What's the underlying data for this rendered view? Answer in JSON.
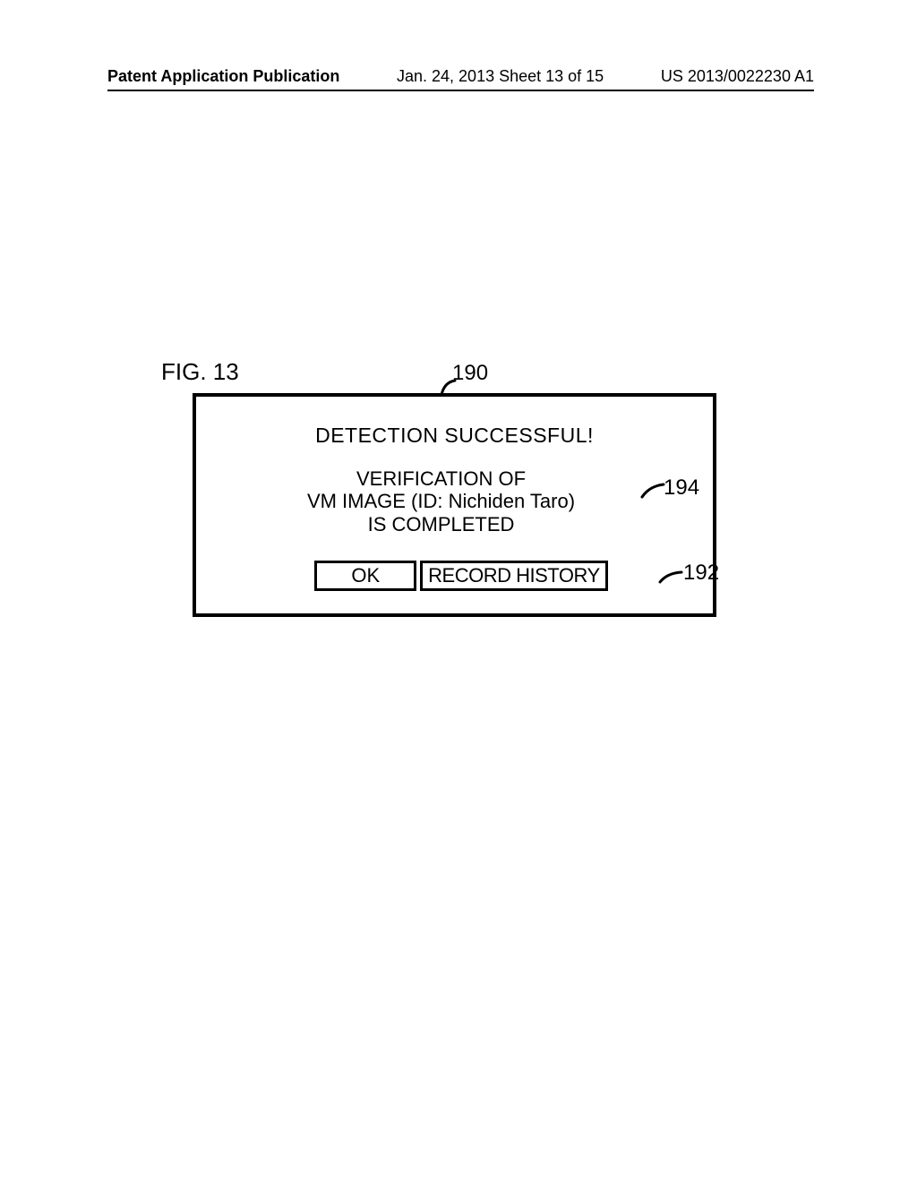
{
  "header": {
    "left": "Patent Application Publication",
    "center": "Jan. 24, 2013  Sheet 13 of 15",
    "right": "US 2013/0022230 A1"
  },
  "figure": {
    "label": "FIG. 13",
    "dialog": {
      "title": "DETECTION SUCCESSFUL!",
      "msg_line1": "VERIFICATION OF",
      "msg_line2": "VM IMAGE (ID: Nichiden Taro)",
      "msg_line3": "IS COMPLETED",
      "ok_label": "OK",
      "record_label": "RECORD HISTORY"
    },
    "callouts": {
      "dialog_ref": "190",
      "msg_ref": "194",
      "record_ref": "192"
    }
  }
}
